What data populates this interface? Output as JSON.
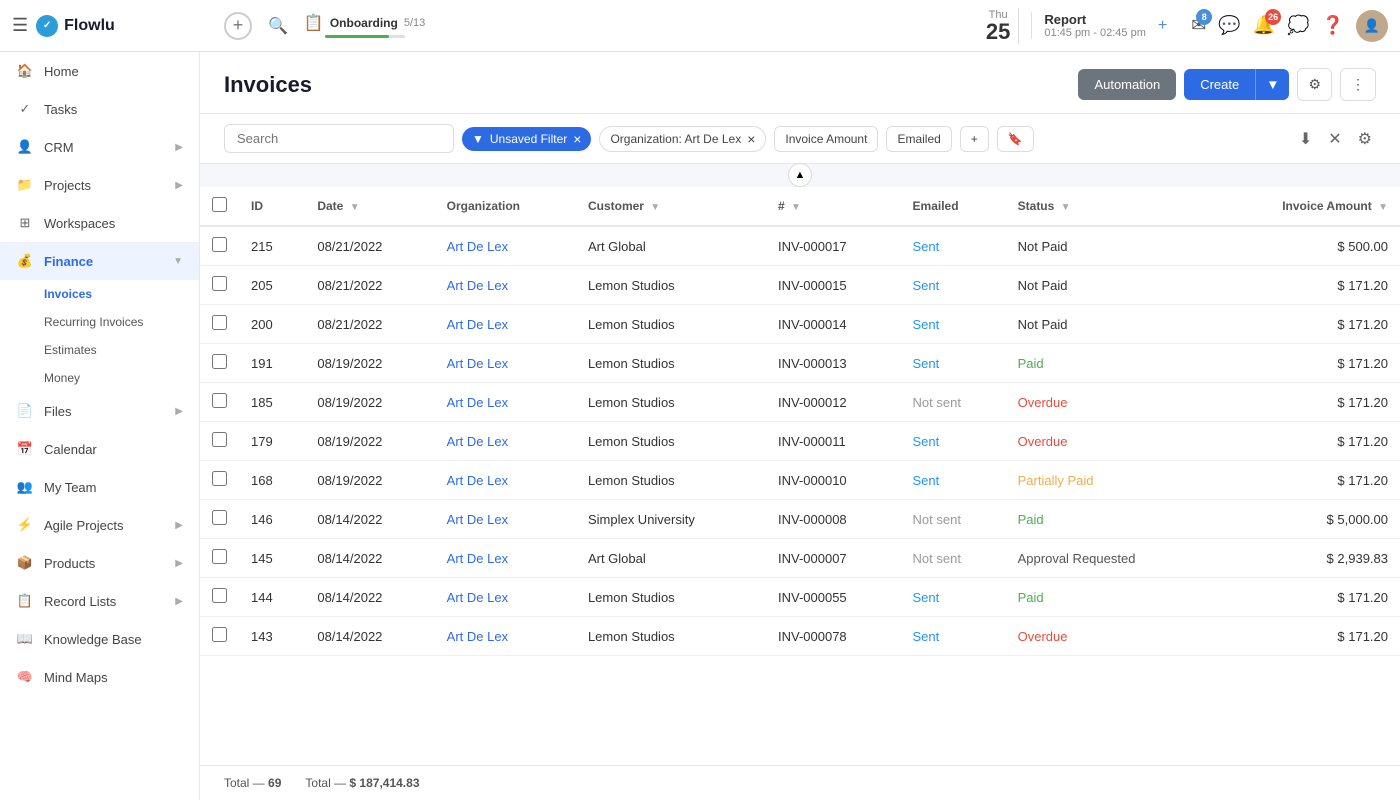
{
  "topbar": {
    "logo_text": "Flowlu",
    "add_label": "+",
    "onboarding_label": "Onboarding",
    "onboarding_progress": "5/13",
    "date_day": "Thu",
    "date_num": "25",
    "report_title": "Report",
    "report_time": "01:45 pm - 02:45 pm",
    "badge_mail": "8",
    "badge_notif": "26"
  },
  "sidebar": {
    "items": [
      {
        "id": "home",
        "label": "Home",
        "icon": "🏠",
        "has_children": false
      },
      {
        "id": "tasks",
        "label": "Tasks",
        "icon": "✓",
        "has_children": false
      },
      {
        "id": "crm",
        "label": "CRM",
        "icon": "👤",
        "has_children": true
      },
      {
        "id": "projects",
        "label": "Projects",
        "icon": "📁",
        "has_children": true
      },
      {
        "id": "workspaces",
        "label": "Workspaces",
        "icon": "⊞",
        "has_children": false
      },
      {
        "id": "finance",
        "label": "Finance",
        "icon": "💰",
        "has_children": true,
        "active": true
      },
      {
        "id": "files",
        "label": "Files",
        "icon": "📄",
        "has_children": true
      },
      {
        "id": "calendar",
        "label": "Calendar",
        "icon": "📅",
        "has_children": false
      },
      {
        "id": "myteam",
        "label": "My Team",
        "icon": "👥",
        "has_children": false
      },
      {
        "id": "agile",
        "label": "Agile Projects",
        "icon": "⚡",
        "has_children": true
      },
      {
        "id": "products",
        "label": "Products",
        "icon": "📦",
        "has_children": true
      },
      {
        "id": "recordlists",
        "label": "Record Lists",
        "icon": "📋",
        "has_children": true
      },
      {
        "id": "knowledgebase",
        "label": "Knowledge Base",
        "icon": "📖",
        "has_children": false
      },
      {
        "id": "mindmaps",
        "label": "Mind Maps",
        "icon": "🧠",
        "has_children": false
      }
    ],
    "finance_subitems": [
      {
        "id": "invoices",
        "label": "Invoices",
        "active": true
      },
      {
        "id": "recurring",
        "label": "Recurring Invoices"
      },
      {
        "id": "estimates",
        "label": "Estimates"
      },
      {
        "id": "money",
        "label": "Money"
      }
    ]
  },
  "page": {
    "title": "Invoices",
    "automation_btn": "Automation",
    "create_btn": "Create"
  },
  "filters": {
    "search_placeholder": "Search",
    "unsaved_filter": "Unsaved Filter",
    "org_filter": "Organization: Art De Lex",
    "amount_filter": "Invoice Amount",
    "emailed_filter": "Emailed"
  },
  "table": {
    "columns": [
      "ID",
      "Date",
      "Organization",
      "Customer",
      "#",
      "Emailed",
      "Status",
      "Invoice Amount"
    ],
    "rows": [
      {
        "id": "215",
        "date": "08/21/2022",
        "org": "Art De Lex",
        "customer": "Art Global",
        "num": "INV-000017",
        "emailed": "Sent",
        "emailed_type": "sent",
        "status": "Not Paid",
        "status_type": "notpaid",
        "amount": "$ 500.00"
      },
      {
        "id": "205",
        "date": "08/21/2022",
        "org": "Art De Lex",
        "customer": "Lemon Studios",
        "num": "INV-000015",
        "emailed": "Sent",
        "emailed_type": "sent",
        "status": "Not Paid",
        "status_type": "notpaid",
        "amount": "$ 171.20"
      },
      {
        "id": "200",
        "date": "08/21/2022",
        "org": "Art De Lex",
        "customer": "Lemon Studios",
        "num": "INV-000014",
        "emailed": "Sent",
        "emailed_type": "sent",
        "status": "Not Paid",
        "status_type": "notpaid",
        "amount": "$ 171.20"
      },
      {
        "id": "191",
        "date": "08/19/2022",
        "org": "Art De Lex",
        "customer": "Lemon Studios",
        "num": "INV-000013",
        "emailed": "Sent",
        "emailed_type": "sent",
        "status": "Paid",
        "status_type": "paid",
        "amount": "$ 171.20"
      },
      {
        "id": "185",
        "date": "08/19/2022",
        "org": "Art De Lex",
        "customer": "Lemon Studios",
        "num": "INV-000012",
        "emailed": "Not sent",
        "emailed_type": "notsent",
        "status": "Overdue",
        "status_type": "overdue",
        "amount": "$ 171.20"
      },
      {
        "id": "179",
        "date": "08/19/2022",
        "org": "Art De Lex",
        "customer": "Lemon Studios",
        "num": "INV-000011",
        "emailed": "Sent",
        "emailed_type": "sent",
        "status": "Overdue",
        "status_type": "overdue",
        "amount": "$ 171.20"
      },
      {
        "id": "168",
        "date": "08/19/2022",
        "org": "Art De Lex",
        "customer": "Lemon Studios",
        "num": "INV-000010",
        "emailed": "Sent",
        "emailed_type": "sent",
        "status": "Partially Paid",
        "status_type": "partial",
        "amount": "$ 171.20"
      },
      {
        "id": "146",
        "date": "08/14/2022",
        "org": "Art De Lex",
        "customer": "Simplex University",
        "num": "INV-000008",
        "emailed": "Not sent",
        "emailed_type": "notsent",
        "status": "Paid",
        "status_type": "paid",
        "amount": "$ 5,000.00"
      },
      {
        "id": "145",
        "date": "08/14/2022",
        "org": "Art De Lex",
        "customer": "Art Global",
        "num": "INV-000007",
        "emailed": "Not sent",
        "emailed_type": "notsent",
        "status": "Approval Requested",
        "status_type": "approval",
        "amount": "$ 2,939.83"
      },
      {
        "id": "144",
        "date": "08/14/2022",
        "org": "Art De Lex",
        "customer": "Lemon Studios",
        "num": "INV-000055",
        "emailed": "Sent",
        "emailed_type": "sent",
        "status": "Paid",
        "status_type": "paid",
        "amount": "$ 171.20"
      },
      {
        "id": "143",
        "date": "08/14/2022",
        "org": "Art De Lex",
        "customer": "Lemon Studios",
        "num": "INV-000078",
        "emailed": "Sent",
        "emailed_type": "sent",
        "status": "Overdue",
        "status_type": "overdue",
        "amount": "$ 171.20"
      }
    ]
  },
  "footer": {
    "total_label": "Total —",
    "total_count": "69",
    "total_amount_label": "Total —",
    "total_amount": "$ 187,414.83"
  }
}
